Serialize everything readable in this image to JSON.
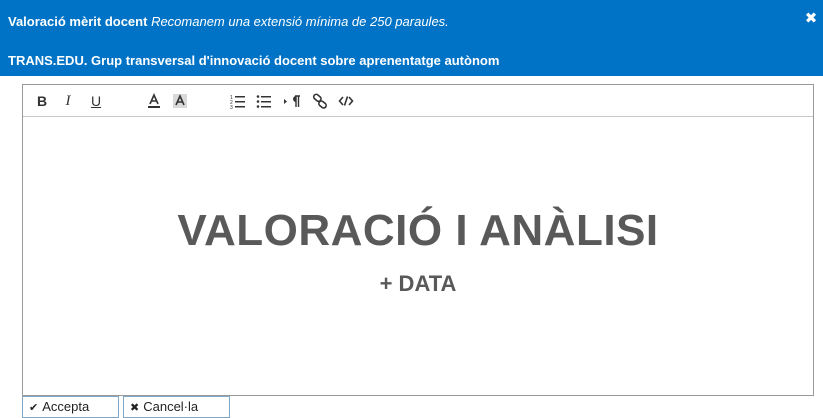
{
  "dialog": {
    "title": "Valoració mèrit docent",
    "title_note": "Recomanem una extensió mínima de 250 paraules.",
    "subtitle": "TRANS.EDU. Grup transversal d'innovació docent sobre aprenentatge autònom",
    "close_symbol": "✖"
  },
  "toolbar": {
    "bold": "B",
    "italic": "I",
    "underline": "U",
    "font_color_icon": "font-color-icon",
    "highlight_icon": "highlight-icon",
    "ordered_list_icon": "ordered-list-icon",
    "unordered_list_icon": "unordered-list-icon",
    "paragraph_icon": "paragraph-icon",
    "link_icon": "link-icon",
    "source_code_icon": "code-icon"
  },
  "editor": {
    "heading": "VALORACIÓ I ANÀLISI",
    "subheading": "+ DATA"
  },
  "buttons": {
    "accept_icon": "✔",
    "accept": "Accepta",
    "cancel_icon": "✖",
    "cancel": "Cancel·la"
  },
  "colors": {
    "header_bg": "#0073c6",
    "content_text": "#595959"
  }
}
